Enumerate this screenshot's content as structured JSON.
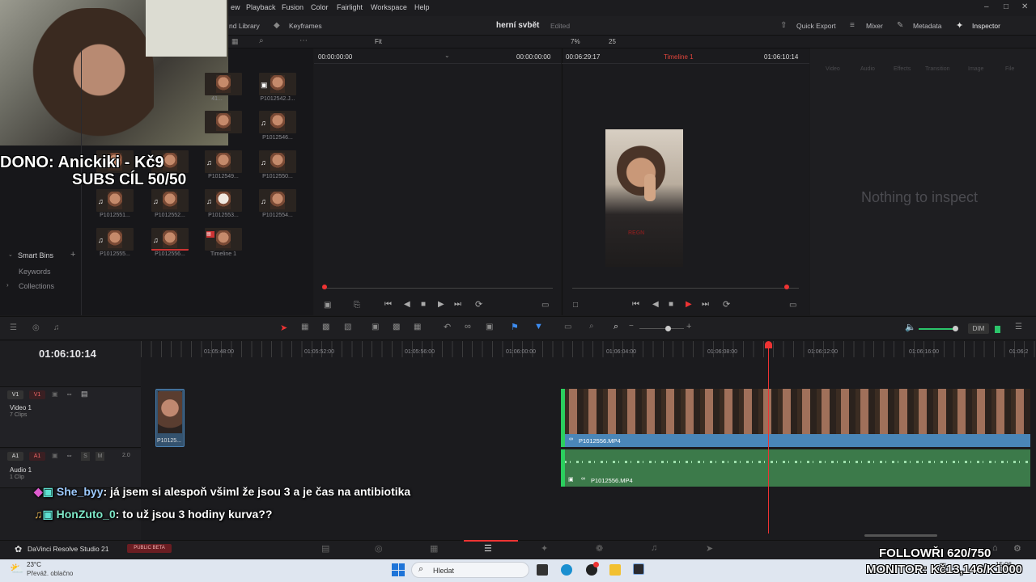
{
  "menu": [
    "ew",
    "Playback",
    "Fusion",
    "Color",
    "Fairlight",
    "Workspace",
    "Help"
  ],
  "toolbar": {
    "media_library": "nd Library",
    "keyframes": "Keyframes",
    "project_title": "herní svbět",
    "edited": "Edited",
    "quick_export": "Quick Export",
    "mixer": "Mixer",
    "metadata": "Metadata",
    "inspector": "Inspector"
  },
  "viewer_bar": {
    "fit": "Fit",
    "zoom": "7%",
    "fps": "25",
    "source_tc_left": "00:00:00:00",
    "source_tc_right": "00:00:00:00",
    "timeline_duration": "00:06:29:17",
    "timeline_name": "Timeline 1",
    "timeline_tc": "01:06:10:14"
  },
  "inspector": {
    "tabs": [
      "Video",
      "Audio",
      "Effects",
      "Transition",
      "Image",
      "File"
    ],
    "empty": "Nothing to inspect"
  },
  "media_pool": {
    "clips_row1": [
      "41...",
      "P1012542.J..."
    ],
    "clips_row2": [
      "P1012546..."
    ],
    "clips_row3": [
      "P1012549...",
      "P1012550..."
    ],
    "clips_row4": [
      "P1012551...",
      "P1012552...",
      "P1012553...",
      "P1012554..."
    ],
    "clips_row5": [
      "P1012555...",
      "P1012556...",
      "Timeline 1"
    ],
    "smart_bins": "Smart Bins",
    "keywords": "Keywords",
    "collections": "Collections"
  },
  "overlay": {
    "dono": "DONO: Anickiki - Kč9",
    "subs": "SUBS CÍL 50/50",
    "follow": "FOLLOWŘI 620/750",
    "monitor": "MONITOR: Kč13,146/K1000"
  },
  "timeline": {
    "timecode": "01:06:10:14",
    "ruler": [
      "01:05:48:00",
      "01:05:52:00",
      "01:05:56:00",
      "01:06:00:00",
      "01:06:04:00",
      "01:06:08:00",
      "01:06:12:00",
      "01:06:16:00",
      "01:06:2"
    ],
    "dim": "DIM",
    "v1_label": "V1",
    "v1_track": "Video 1",
    "v1_clips": "7 Clips",
    "a1_label": "A1",
    "a1_track": "Audio 1",
    "a1_clips": "1 Clip",
    "a1_channels": "2.0",
    "s": "S",
    "m": "M",
    "small_clip": "P10125...",
    "video_clip": "P1012556.MP4",
    "audio_clip": "P1012556.MP4"
  },
  "chat": [
    {
      "user": "She_byy",
      "text": ": já jsem si alespoň všiml že jsou 3 a je čas na antibiotika",
      "color": "#9ecbff"
    },
    {
      "user": "HonZuto_0",
      "text": ": to už jsou 3 hodiny kurva??",
      "color": "#7ee8c8"
    }
  ],
  "bottom_bar": {
    "app_name": "DaVinci Resolve Studio 21",
    "badge": "PUBLIC BETA"
  },
  "taskbar": {
    "temp": "23°C",
    "weather": "Převáž. oblačno",
    "search_placeholder": "Hledat",
    "time": "15:06"
  }
}
